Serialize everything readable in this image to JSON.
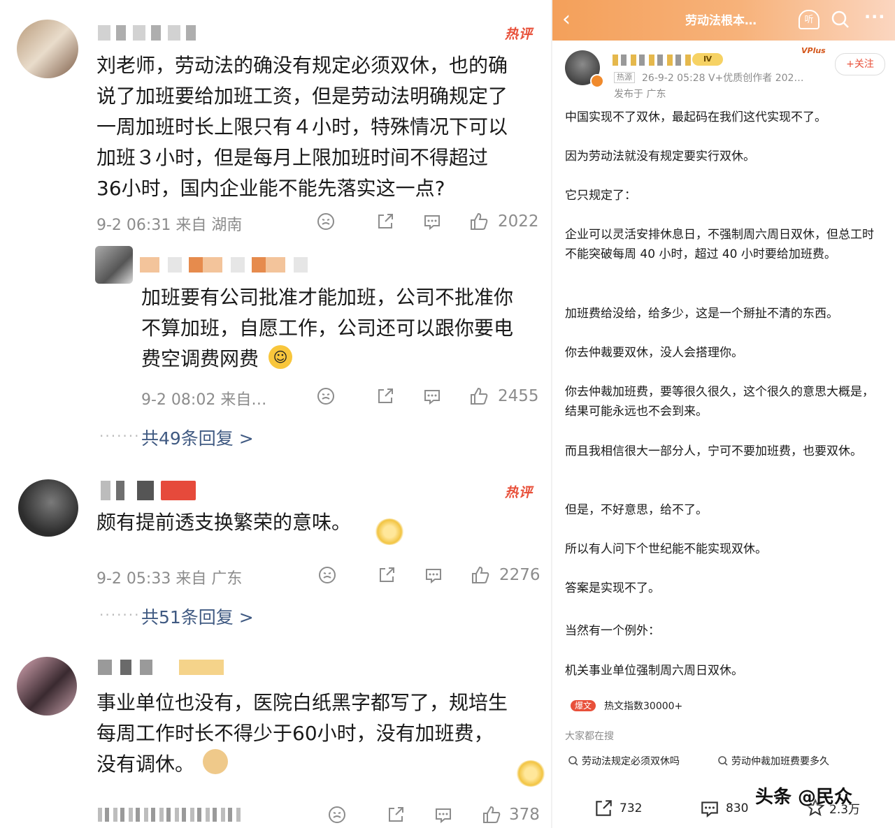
{
  "comments": [
    {
      "text": "刘老师，劳动法的确没有规定必须双休，也的确\n说了加班要给加班工资，但是劳动法明确规定了\n一周加班时长上限只有４小时，特殊情况下可以\n加班３小时，但是每月上限加班时间不得超过\n36小时，国内企业能不能先落实这一点?",
      "hot": "热评",
      "meta": "9-2 06:31 来自 湖南",
      "likes": "2022"
    },
    {
      "text": "加班要有公司批准才能加班，公司不批准你\n不算加班，自愿工作，公司还可以跟你要电\n费空调费网费",
      "meta": "9-2 08:02 来自…",
      "likes": "2455"
    },
    {
      "replies": "共49条回复 >"
    },
    {
      "text": "颇有提前透支换繁荣的意味。",
      "hot": "热评",
      "meta": "9-2 05:33 来自 广东",
      "likes": "2276",
      "replies": "共51条回复 >"
    },
    {
      "text": "事业单位也没有，医院白纸黑字都写了，规培生\n每周工作时长不得少于60小时，没有加班费，\n没有调休。",
      "likes": "378"
    }
  ],
  "right": {
    "topbar_title": "劳动法根本…",
    "listen_label": "听",
    "follow_label": "+关注",
    "vplus": "VPlus",
    "author_meta": "26-9-2 05:28  V+优质创作者 202…",
    "hot_badge": "热源",
    "publish_loc": "发布于 广东",
    "paragraphs": [
      "中国实现不了双休，最起码在我们这代实现不了。",
      "因为劳动法就没有规定要实行双休。",
      "它只规定了：",
      "企业可以灵活安排休息日，不强制周六周日双休，但总工时不能突破每周 40 小时，超过 40 小时要给加班费。",
      "加班费给没给，给多少，这是一个掰扯不清的东西。",
      "你去仲裁要双休，没人会搭理你。",
      "你去仲裁加班费，要等很久很久，这个很久的意思大概是，结果可能永远也不会到来。",
      "而且我相信很大一部分人，宁可不要加班费，也要双休。",
      "但是，不好意思，给不了。",
      "所以有人问下个世纪能不能实现双休。",
      "答案是实现不了。",
      "当然有一个例外：",
      "机关事业单位强制周六周日双休。"
    ],
    "hot_index_badge": "爆文",
    "hot_index": "热文指数30000+",
    "searching_label": "大家都在搜",
    "search_tags": [
      "劳动法规定必须双休吗",
      "劳动仲裁加班费要多久"
    ],
    "share_count": "732",
    "comment_count": "830",
    "fav_count": "2.3万",
    "watermark": "头条 @民众"
  },
  "colors": {
    "accent_orange": "#f4a05a",
    "hot_red": "#e8503a",
    "link_blue": "#405a82",
    "meta_gray": "#8c8c8c"
  }
}
